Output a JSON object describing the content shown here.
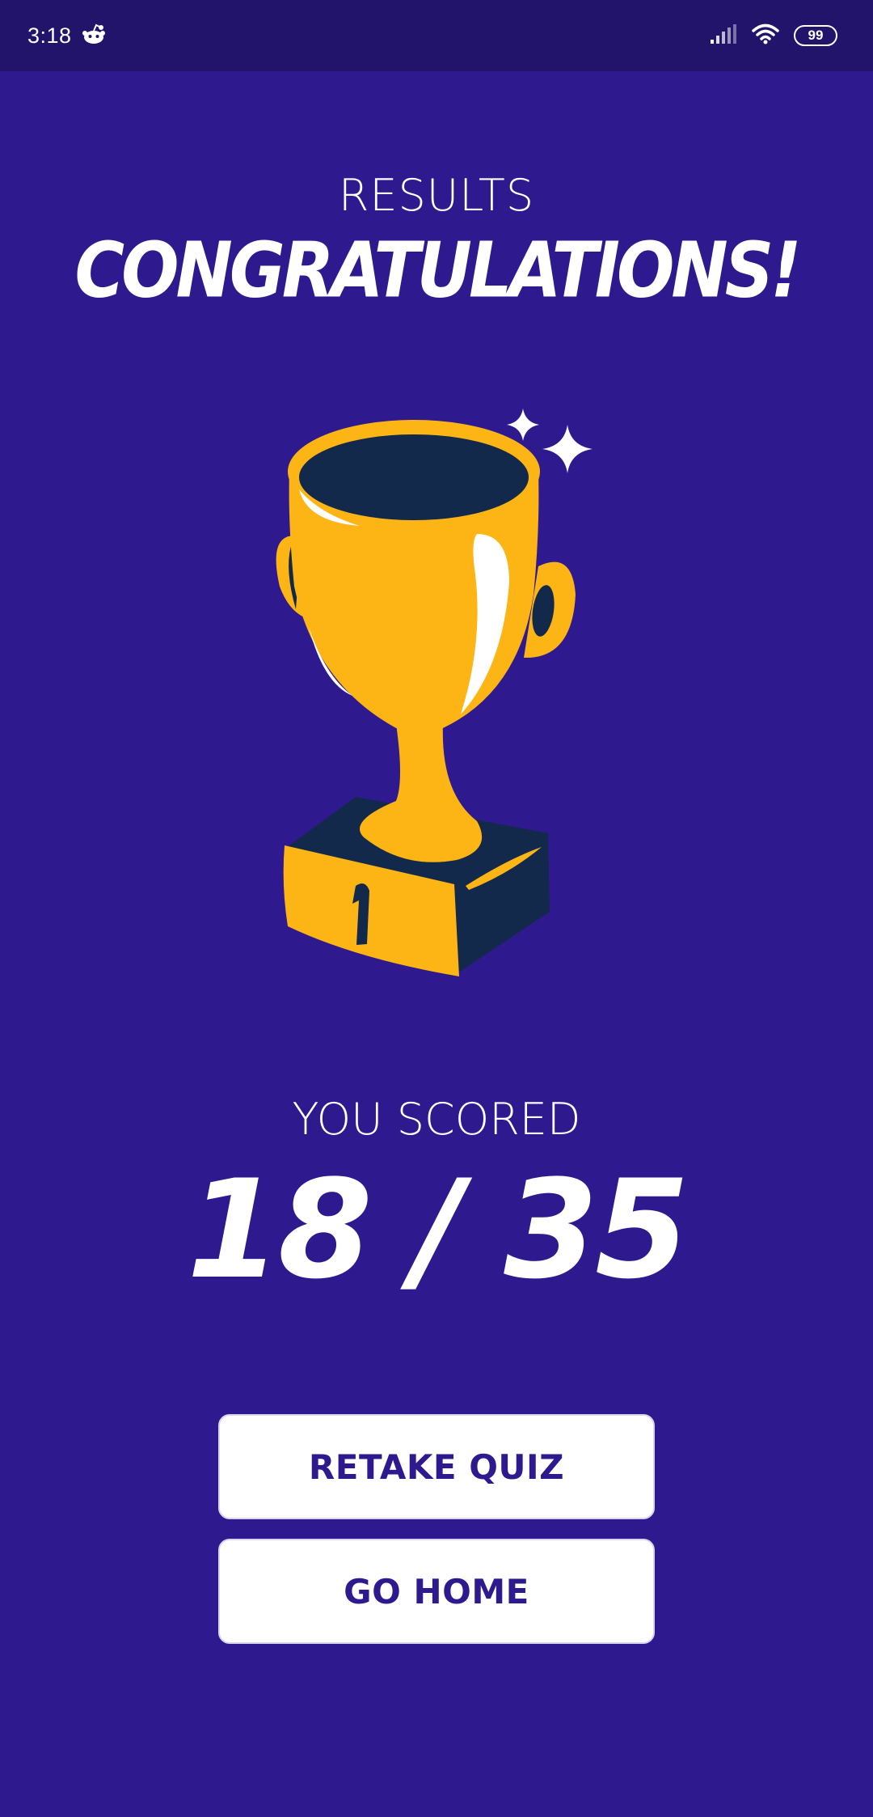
{
  "status_bar": {
    "time": "3:18",
    "battery": "99",
    "icons": [
      "reddit-icon",
      "signal-icon",
      "wifi-icon",
      "battery-icon"
    ]
  },
  "results": {
    "label": "RESULTS",
    "headline": "CONGRATULATIONS!"
  },
  "trophy": {
    "place_number": "1",
    "colors": {
      "gold": "#fdb515",
      "navy": "#13294b",
      "highlight": "#ffffff"
    }
  },
  "score": {
    "label": "YOU SCORED",
    "value": "18 / 35",
    "correct": 18,
    "total": 35
  },
  "buttons": {
    "retake": "RETAKE QUIZ",
    "home": "GO HOME"
  },
  "colors": {
    "background": "#2e1a8e",
    "status_bar": "#22146b",
    "button_text": "#2e1a8e"
  }
}
